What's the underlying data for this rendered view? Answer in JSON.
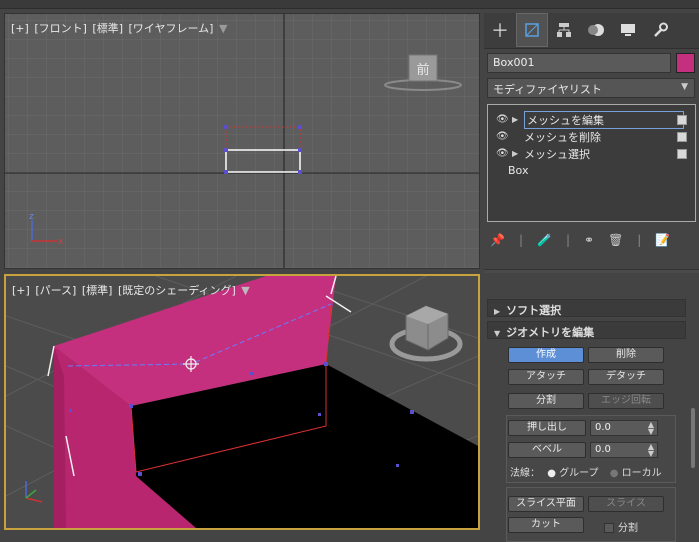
{
  "viewport_front": {
    "label": [
      "[+]",
      "[フロント]",
      "[標準]",
      "[ワイヤフレーム]"
    ],
    "viewcube": "前"
  },
  "viewport_persp": {
    "label": [
      "[+]",
      "[パース]",
      "[標準]",
      "[既定のシェーディング]"
    ]
  },
  "panel": {
    "object_name": "Box001",
    "object_color": "#c5307e",
    "modifier_list": "モディファイヤリスト",
    "stack": [
      {
        "label": "メッシュを編集",
        "expandable": true,
        "selected": true
      },
      {
        "label": "メッシュを削除",
        "expandable": false,
        "selected": false
      },
      {
        "label": "メッシュ選択",
        "expandable": true,
        "selected": false
      }
    ],
    "stack_base": "Box",
    "rollouts": {
      "soft": "ソフト選択",
      "geom": "ジオメトリを編集"
    },
    "buttons": {
      "create": "作成",
      "delete": "削除",
      "attach": "アタッチ",
      "detach": "デタッチ",
      "divide": "分割",
      "edge_turn": "エッジ回転",
      "extrude": "押し出し",
      "bevel": "ベベル",
      "slice_plane": "スライス平面",
      "slice": "スライス",
      "cut": "カット",
      "split": "分割"
    },
    "extrude_value": "0.0",
    "bevel_value": "0.0",
    "normals_label": "法線：",
    "normals_group": "グループ",
    "normals_local": "ローカル"
  },
  "colors": {
    "accent": "#5d8fd6",
    "active_border": "#c8a23c",
    "box_face": "#c5307e"
  }
}
